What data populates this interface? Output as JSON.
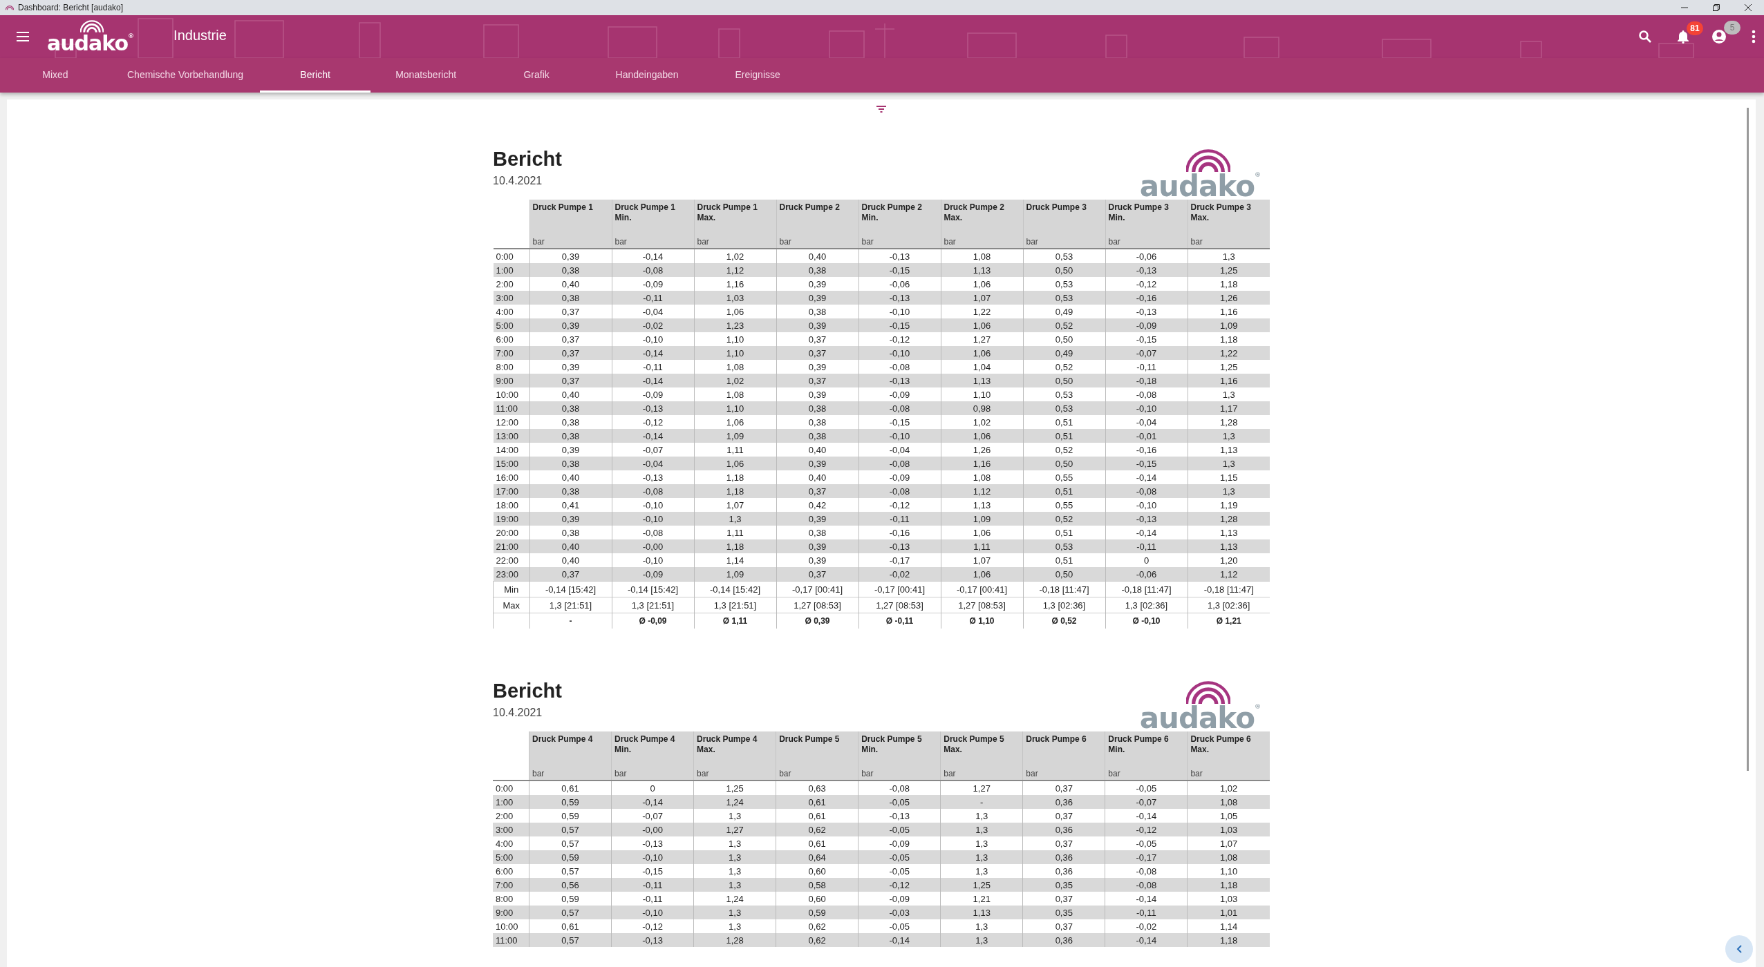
{
  "window": {
    "title": "Dashboard: Bericht [audako]"
  },
  "header": {
    "logo": "audako$^{®}$",
    "title": "Industrie",
    "notifications": "81",
    "user_badge": "5"
  },
  "tabs": [
    {
      "label": "Mixed",
      "selected": false
    },
    {
      "label": "Chemische Vorbehandlung",
      "selected": false
    },
    {
      "label": "Bericht",
      "selected": true
    },
    {
      "label": "Monatsbericht",
      "selected": false
    },
    {
      "label": "Grafik",
      "selected": false
    },
    {
      "label": "Handeingaben",
      "selected": false
    },
    {
      "label": "Ereignisse",
      "selected": false
    }
  ],
  "reports": [
    {
      "title": "Bericht",
      "date": "10.4.2021",
      "logo": "audako$^{®}$",
      "columns": [
        {
          "lines": [
            "Druck Pumpe 1"
          ],
          "unit": "bar"
        },
        {
          "lines": [
            "Druck Pumpe 1",
            "Min."
          ],
          "unit": "bar"
        },
        {
          "lines": [
            "Druck Pumpe 1",
            "Max."
          ],
          "unit": "bar"
        },
        {
          "lines": [
            "Druck Pumpe 2"
          ],
          "unit": "bar"
        },
        {
          "lines": [
            "Druck Pumpe 2",
            "Min."
          ],
          "unit": "bar"
        },
        {
          "lines": [
            "Druck Pumpe 2",
            "Max."
          ],
          "unit": "bar"
        },
        {
          "lines": [
            "Druck Pumpe 3"
          ],
          "unit": "bar"
        },
        {
          "lines": [
            "Druck Pumpe 3",
            "Min."
          ],
          "unit": "bar"
        },
        {
          "lines": [
            "Druck Pumpe 3",
            "Max."
          ],
          "unit": "bar"
        }
      ],
      "rows": [
        {
          "time": "0:00",
          "values": [
            "0,39",
            "-0,14",
            "1,02",
            "0,40",
            "-0,13",
            "1,08",
            "0,53",
            "-0,06",
            "1,3"
          ]
        },
        {
          "time": "1:00",
          "values": [
            "0,38",
            "-0,08",
            "1,12",
            "0,38",
            "-0,15",
            "1,13",
            "0,50",
            "-0,13",
            "1,25"
          ]
        },
        {
          "time": "2:00",
          "values": [
            "0,40",
            "-0,09",
            "1,16",
            "0,39",
            "-0,06",
            "1,06",
            "0,53",
            "-0,12",
            "1,18"
          ]
        },
        {
          "time": "3:00",
          "values": [
            "0,38",
            "-0,11",
            "1,03",
            "0,39",
            "-0,13",
            "1,07",
            "0,53",
            "-0,16",
            "1,26"
          ]
        },
        {
          "time": "4:00",
          "values": [
            "0,37",
            "-0,04",
            "1,06",
            "0,38",
            "-0,10",
            "1,22",
            "0,49",
            "-0,13",
            "1,16"
          ]
        },
        {
          "time": "5:00",
          "values": [
            "0,39",
            "-0,02",
            "1,23",
            "0,39",
            "-0,15",
            "1,06",
            "0,52",
            "-0,09",
            "1,09"
          ]
        },
        {
          "time": "6:00",
          "values": [
            "0,37",
            "-0,10",
            "1,10",
            "0,37",
            "-0,12",
            "1,27",
            "0,50",
            "-0,15",
            "1,18"
          ]
        },
        {
          "time": "7:00",
          "values": [
            "0,37",
            "-0,14",
            "1,10",
            "0,37",
            "-0,10",
            "1,06",
            "0,49",
            "-0,07",
            "1,22"
          ]
        },
        {
          "time": "8:00",
          "values": [
            "0,39",
            "-0,11",
            "1,08",
            "0,39",
            "-0,08",
            "1,04",
            "0,52",
            "-0,11",
            "1,25"
          ]
        },
        {
          "time": "9:00",
          "values": [
            "0,37",
            "-0,14",
            "1,02",
            "0,37",
            "-0,13",
            "1,13",
            "0,50",
            "-0,18",
            "1,16"
          ]
        },
        {
          "time": "10:00",
          "values": [
            "0,40",
            "-0,09",
            "1,08",
            "0,39",
            "-0,09",
            "1,10",
            "0,53",
            "-0,08",
            "1,3"
          ]
        },
        {
          "time": "11:00",
          "values": [
            "0,38",
            "-0,13",
            "1,10",
            "0,38",
            "-0,08",
            "0,98",
            "0,53",
            "-0,10",
            "1,17"
          ]
        },
        {
          "time": "12:00",
          "values": [
            "0,38",
            "-0,12",
            "1,06",
            "0,38",
            "-0,15",
            "1,02",
            "0,51",
            "-0,04",
            "1,28"
          ]
        },
        {
          "time": "13:00",
          "values": [
            "0,38",
            "-0,14",
            "1,09",
            "0,38",
            "-0,10",
            "1,06",
            "0,51",
            "-0,01",
            "1,3"
          ]
        },
        {
          "time": "14:00",
          "values": [
            "0,39",
            "-0,07",
            "1,11",
            "0,40",
            "-0,04",
            "1,26",
            "0,52",
            "-0,16",
            "1,13"
          ]
        },
        {
          "time": "15:00",
          "values": [
            "0,38",
            "-0,04",
            "1,06",
            "0,39",
            "-0,08",
            "1,16",
            "0,50",
            "-0,15",
            "1,3"
          ]
        },
        {
          "time": "16:00",
          "values": [
            "0,40",
            "-0,13",
            "1,18",
            "0,40",
            "-0,09",
            "1,08",
            "0,55",
            "-0,14",
            "1,15"
          ]
        },
        {
          "time": "17:00",
          "values": [
            "0,38",
            "-0,08",
            "1,18",
            "0,37",
            "-0,08",
            "1,12",
            "0,51",
            "-0,08",
            "1,3"
          ]
        },
        {
          "time": "18:00",
          "values": [
            "0,41",
            "-0,10",
            "1,07",
            "0,42",
            "-0,12",
            "1,13",
            "0,55",
            "-0,10",
            "1,19"
          ]
        },
        {
          "time": "19:00",
          "values": [
            "0,39",
            "-0,10",
            "1,3",
            "0,39",
            "-0,11",
            "1,09",
            "0,52",
            "-0,13",
            "1,28"
          ]
        },
        {
          "time": "20:00",
          "values": [
            "0,38",
            "-0,08",
            "1,11",
            "0,38",
            "-0,16",
            "1,06",
            "0,51",
            "-0,14",
            "1,13"
          ]
        },
        {
          "time": "21:00",
          "values": [
            "0,40",
            "-0,00",
            "1,18",
            "0,39",
            "-0,13",
            "1,11",
            "0,53",
            "-0,11",
            "1,13"
          ]
        },
        {
          "time": "22:00",
          "values": [
            "0,40",
            "-0,10",
            "1,14",
            "0,39",
            "-0,17",
            "1,07",
            "0,51",
            "0",
            "1,20"
          ]
        },
        {
          "time": "23:00",
          "values": [
            "0,37",
            "-0,09",
            "1,09",
            "0,37",
            "-0,02",
            "1,06",
            "0,50",
            "-0,06",
            "1,12"
          ]
        }
      ],
      "summary_rows": [
        {
          "kind": "plain",
          "label": "Min",
          "values": [
            "-0,14 [15:42]",
            "-0,14 [15:42]",
            "-0,14 [15:42]",
            "-0,17 [00:41]",
            "-0,17 [00:41]",
            "-0,17 [00:41]",
            "-0,18 [11:47]",
            "-0,18 [11:47]",
            "-0,18 [11:47]"
          ]
        },
        {
          "kind": "plain",
          "label": "Max",
          "values": [
            "1,3 [21:51]",
            "1,3 [21:51]",
            "1,3 [21:51]",
            "1,27 [08:53]",
            "1,27 [08:53]",
            "1,27 [08:53]",
            "1,3 [02:36]",
            "1,3 [02:36]",
            "1,3 [02:36]"
          ]
        },
        {
          "kind": "average",
          "values": [
            "-",
            "Ø -0,09",
            "Ø 1,11",
            "Ø 0,39",
            "Ø -0,11",
            "Ø 1,10",
            "Ø 0,52",
            "Ø -0,10",
            "Ø 1,21"
          ]
        }
      ]
    },
    {
      "title": "Bericht",
      "date": "10.4.2021",
      "logo": "audako$^{®}$",
      "columns": [
        {
          "lines": [
            "Druck Pumpe 4"
          ],
          "unit": "bar"
        },
        {
          "lines": [
            "Druck Pumpe 4",
            "Min."
          ],
          "unit": "bar"
        },
        {
          "lines": [
            "Druck Pumpe 4",
            "Max."
          ],
          "unit": "bar"
        },
        {
          "lines": [
            "Druck Pumpe 5"
          ],
          "unit": "bar"
        },
        {
          "lines": [
            "Druck Pumpe 5",
            "Min."
          ],
          "unit": "bar"
        },
        {
          "lines": [
            "Druck Pumpe 5",
            "Max."
          ],
          "unit": "bar"
        },
        {
          "lines": [
            "Druck Pumpe 6"
          ],
          "unit": "bar"
        },
        {
          "lines": [
            "Druck Pumpe 6",
            "Min."
          ],
          "unit": "bar"
        },
        {
          "lines": [
            "Druck Pumpe 6",
            "Max."
          ],
          "unit": "bar"
        }
      ],
      "rows": [
        {
          "time": "0:00",
          "values": [
            "0,61",
            "0",
            "1,25",
            "0,63",
            "-0,08",
            "1,27",
            "0,37",
            "-0,05",
            "1,02"
          ]
        },
        {
          "time": "1:00",
          "values": [
            "0,59",
            "-0,14",
            "1,24",
            "0,61",
            "-0,05",
            "-",
            "0,36",
            "-0,07",
            "1,08"
          ]
        },
        {
          "time": "2:00",
          "values": [
            "0,59",
            "-0,07",
            "1,3",
            "0,61",
            "-0,13",
            "1,3",
            "0,37",
            "-0,14",
            "1,05"
          ]
        },
        {
          "time": "3:00",
          "values": [
            "0,57",
            "-0,00",
            "1,27",
            "0,62",
            "-0,05",
            "1,3",
            "0,36",
            "-0,12",
            "1,03"
          ]
        },
        {
          "time": "4:00",
          "values": [
            "0,57",
            "-0,13",
            "1,3",
            "0,61",
            "-0,09",
            "1,3",
            "0,37",
            "-0,05",
            "1,07"
          ]
        },
        {
          "time": "5:00",
          "values": [
            "0,59",
            "-0,10",
            "1,3",
            "0,64",
            "-0,05",
            "1,3",
            "0,36",
            "-0,17",
            "1,08"
          ]
        },
        {
          "time": "6:00",
          "values": [
            "0,57",
            "-0,15",
            "1,3",
            "0,60",
            "-0,05",
            "1,3",
            "0,36",
            "-0,08",
            "1,10"
          ]
        },
        {
          "time": "7:00",
          "values": [
            "0,56",
            "-0,11",
            "1,3",
            "0,58",
            "-0,12",
            "1,25",
            "0,35",
            "-0,08",
            "1,18"
          ]
        },
        {
          "time": "8:00",
          "values": [
            "0,59",
            "-0,11",
            "1,24",
            "0,60",
            "-0,09",
            "1,21",
            "0,37",
            "-0,14",
            "1,03"
          ]
        },
        {
          "time": "9:00",
          "values": [
            "0,57",
            "-0,10",
            "1,3",
            "0,59",
            "-0,03",
            "1,13",
            "0,35",
            "-0,11",
            "1,01"
          ]
        },
        {
          "time": "10:00",
          "values": [
            "0,61",
            "-0,12",
            "1,3",
            "0,62",
            "-0,05",
            "1,3",
            "0,37",
            "-0,02",
            "1,14"
          ]
        },
        {
          "time": "11:00",
          "values": [
            "0,57",
            "-0,13",
            "1,28",
            "0,62",
            "-0,14",
            "1,3",
            "0,36",
            "-0,14",
            "1,18"
          ]
        }
      ]
    }
  ]
}
